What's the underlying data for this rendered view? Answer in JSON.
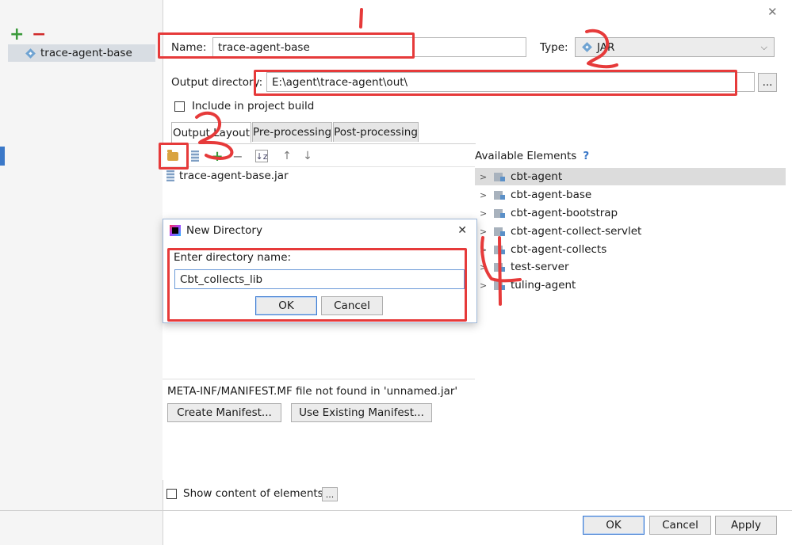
{
  "window": {
    "close_glyph": "✕"
  },
  "toolbar": {
    "add_glyph": "+",
    "remove_glyph": "−"
  },
  "artifacts": {
    "items": [
      {
        "label": "trace-agent-base",
        "icon": "jar-icon"
      }
    ]
  },
  "form": {
    "name_label": "Name:",
    "name_value": "trace-agent-base",
    "type_label": "Type:",
    "type_value": "JAR",
    "output_dir_label": "Output directory:",
    "output_dir_value": "E:\\agent\\trace-agent\\out\\",
    "browse_label": "...",
    "include_label": "Include in project build"
  },
  "tabs": [
    {
      "label": "Output Layout",
      "active": true
    },
    {
      "label": "Pre-processing",
      "active": false
    },
    {
      "label": "Post-processing",
      "active": false
    }
  ],
  "layout": {
    "tree_item": "trace-agent-base.jar",
    "manifest_msg": "META-INF/MANIFEST.MF file not found in 'unnamed.jar'",
    "create_manifest": "Create Manifest...",
    "use_manifest": "Use Existing Manifest...",
    "show_content_label": "Show content of elements",
    "show_content_btn": "..."
  },
  "available": {
    "title": "Available Elements",
    "help_glyph": "?",
    "items": [
      "cbt-agent",
      "cbt-agent-base",
      "cbt-agent-bootstrap",
      "cbt-agent-collect-servlet",
      "cbt-agent-collects",
      "test-server",
      "tuling-agent"
    ]
  },
  "dialog": {
    "title": "New Directory",
    "prompt": "Enter directory name:",
    "value": "Cbt_collects_lib",
    "ok": "OK",
    "cancel": "Cancel",
    "close_glyph": "✕"
  },
  "footer": {
    "ok": "OK",
    "cancel": "Cancel",
    "apply": "Apply"
  },
  "colors": {
    "annotation": "#e63a3a",
    "accent": "#3b78c8",
    "selection": "#dcdcdc"
  }
}
